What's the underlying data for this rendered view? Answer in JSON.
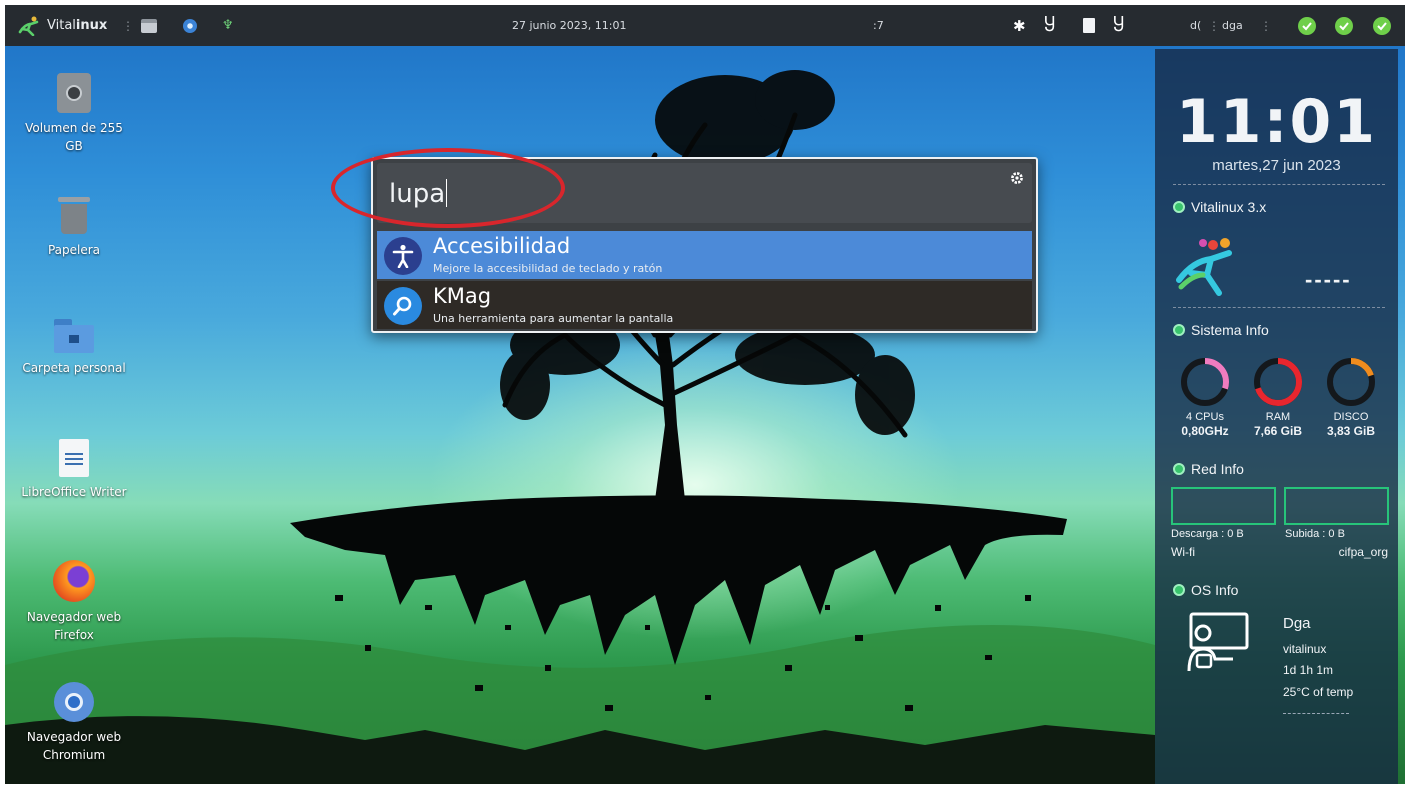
{
  "panel": {
    "brand": {
      "prefix": "Vital",
      "bold": "inux"
    },
    "datetime": "27 junio 2023, 11:01",
    "status_partial": ":7",
    "user_partial": "d(",
    "user": "dga",
    "sep1": "⋮",
    "sep2": "⋮",
    "sep3": "⋮",
    "sep4": "⋮"
  },
  "desktop": {
    "icons": [
      {
        "label": "Volumen de 255 GB",
        "icon": "drive-icon"
      },
      {
        "label": "Papelera",
        "icon": "trash-icon"
      },
      {
        "label": "Carpeta personal",
        "icon": "home-folder-icon"
      },
      {
        "label": "LibreOffice Writer",
        "icon": "writer-icon"
      },
      {
        "label": "Navegador web Firefox",
        "icon": "firefox-icon"
      },
      {
        "label": "Navegador web Chromium",
        "icon": "chromium-icon"
      }
    ]
  },
  "krunner": {
    "query": "lupa",
    "results": [
      {
        "title": "Accesibilidad",
        "subtitle": "Mejore la accesibilidad de teclado y ratón",
        "icon": "accessibility-icon",
        "selected": true
      },
      {
        "title": "KMag",
        "subtitle": "Una herramienta para aumentar la pantalla",
        "icon": "magnifier-icon",
        "selected": false
      }
    ]
  },
  "widget": {
    "clock": "11:01",
    "date": "martes,27 jun 2023",
    "vitalinux_title": "Vitalinux 3.x",
    "vitalinux_value": "-----",
    "sistema_title": "Sistema Info",
    "gauges": [
      {
        "label": "4 CPUs",
        "value": "0,80GHz",
        "color": "#f07cc0",
        "fraction": 0.3
      },
      {
        "label": "RAM",
        "value": "7,66 GiB",
        "color": "#e8262e",
        "fraction": 0.7
      },
      {
        "label": "DISCO",
        "value": "3,83 GiB",
        "color": "#f08c1e",
        "fraction": 0.2
      }
    ],
    "red_title": "Red Info",
    "descarga": "Descarga : 0 B",
    "subida": "Subida : 0 B",
    "iface": "Wi-fi",
    "ssid": "cifpa_org",
    "os_title": "OS Info",
    "os_user": "Dga",
    "os_host": "vitalinux",
    "os_uptime": "1d 1h 1m",
    "os_temp": "25°C of temp"
  },
  "colors": {
    "panel_bg": "#262b30",
    "selected_row": "#4c8ad8",
    "unselected_row": "#2e2a26",
    "highlight_circle": "#d8262c",
    "accent_green": "#39c46d"
  }
}
